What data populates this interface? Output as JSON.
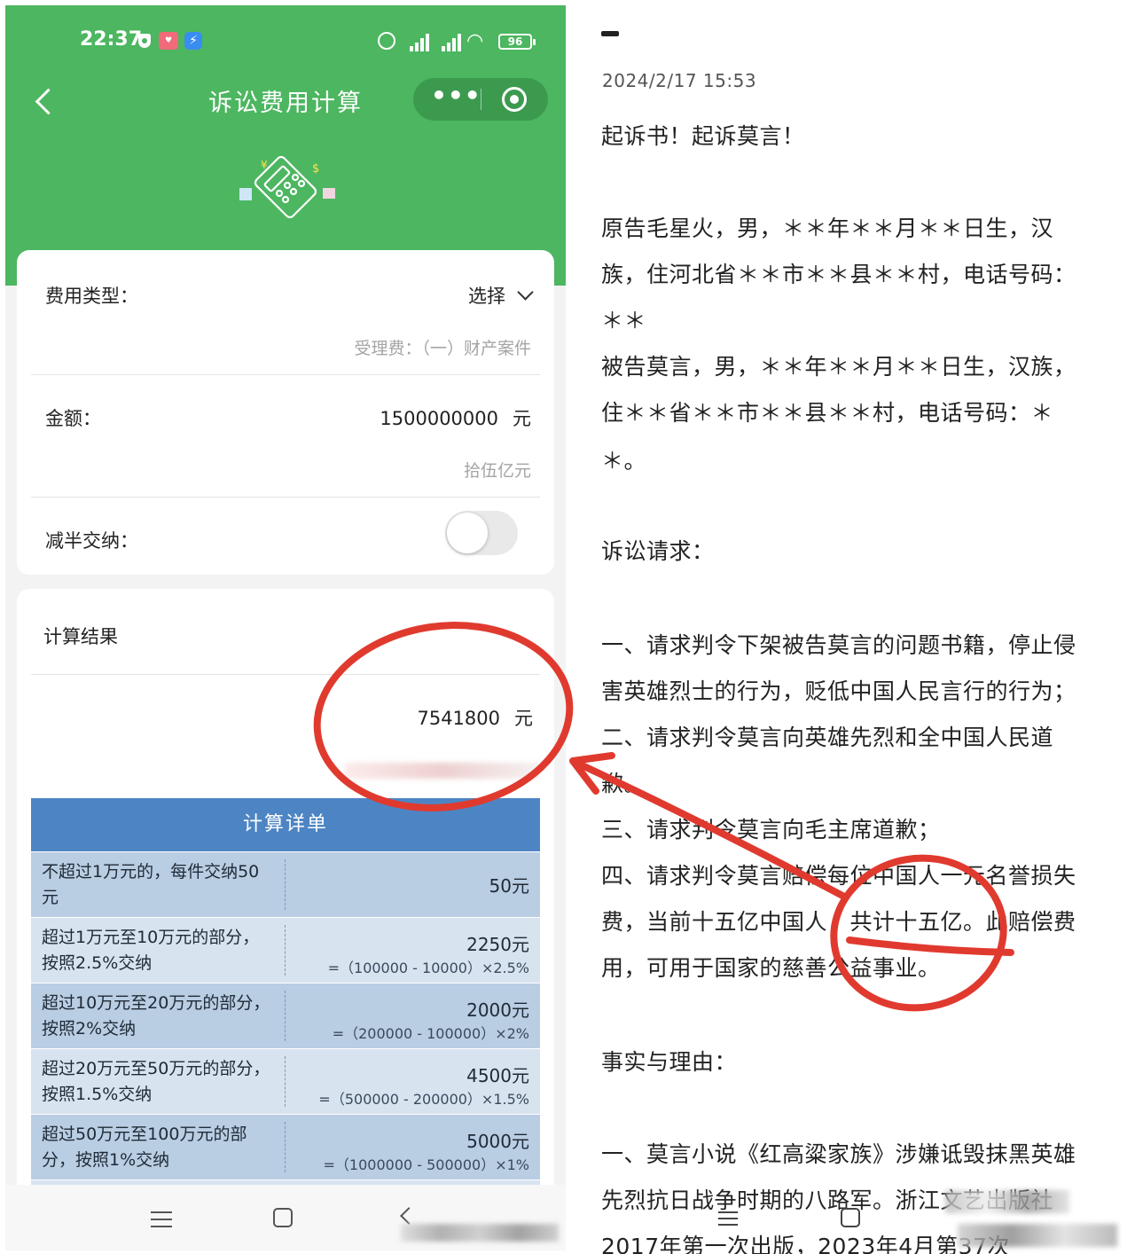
{
  "left_phone": {
    "status_bar": {
      "time": "22:37",
      "battery": "96"
    },
    "nav": {
      "title": "诉讼费用计算"
    },
    "form": {
      "fee_type_label": "费用类型：",
      "fee_type_value": "选择",
      "fee_type_sub": "受理费：（一）财产案件",
      "amount_label": "金额：",
      "amount_value": "1500000000",
      "amount_unit": "元",
      "amount_chinese": "拾伍亿元",
      "half_label": "减半交纳："
    },
    "result": {
      "title": "计算结果",
      "value": "7541800",
      "unit": "元"
    },
    "detail": {
      "header": "计算详单",
      "rows": [
        {
          "desc": "不超过1万元的，每件交纳50元",
          "amount": "50元",
          "formula": ""
        },
        {
          "desc": "超过1万元至10万元的部分，按照2.5%交纳",
          "amount": "2250元",
          "formula": "=（100000 - 10000）×2.5%"
        },
        {
          "desc": "超过10万元至20万元的部分，按照2%交纳",
          "amount": "2000元",
          "formula": "=（200000 - 100000）×2%"
        },
        {
          "desc": "超过20万元至50万元的部分，按照1.5%交纳",
          "amount": "4500元",
          "formula": "=（500000 - 200000）×1.5%"
        },
        {
          "desc": "超过50万元至100万元的部分，按照1%交纳",
          "amount": "5000元",
          "formula": "=（1000000 - 500000）×1%"
        }
      ]
    }
  },
  "document": {
    "timestamp": "2024/2/17 15:53",
    "lines": [
      "起诉书！起诉莫言！",
      "原告毛星火，男，＊＊年＊＊月＊＊日生，汉",
      "族，住河北省＊＊市＊＊县＊＊村，电话号码：",
      "＊＊",
      "被告莫言，男，＊＊年＊＊月＊＊日生，汉族，",
      "住＊＊省＊＊市＊＊县＊＊村，电话号码：＊",
      "＊。",
      "诉讼请求：",
      "一、请求判令下架被告莫言的问题书籍，停止侵",
      "害英雄烈士的行为，贬低中国人民言行的行为；",
      "二、请求判令莫言向英雄先烈和全中国人民道",
      "歉。",
      "三、请求判令莫言向毛主席道歉；",
      "四、请求判令莫言赔偿每位中国人一元名誉损失",
      "费，当前十五亿中国人，共计十五亿。此赔偿费",
      "用，可用于国家的慈善公益事业。",
      "事实与理由：",
      "一、莫言小说《红高粱家族》涉嫌诋毁抹黑英雄",
      "先烈抗日战争时期的八路军。浙江文艺出版社",
      "2017年第一次出版，2023年4月第37次"
    ]
  },
  "colors": {
    "header_green": "#4cb660",
    "detail_blue": "#4d85c4",
    "row_blue_dark": "#b9cde3",
    "row_blue_light": "#d8e3f0",
    "annotation_red": "#e03a2f"
  }
}
